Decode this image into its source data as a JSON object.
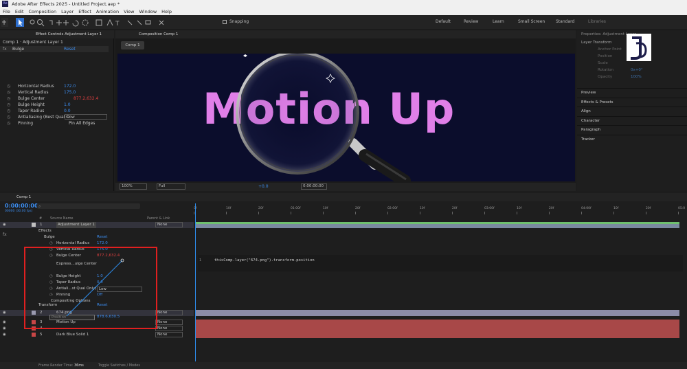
{
  "titlebar": {
    "app_icon": "Ae",
    "title": "Adobe After Effects 2025 - Untitled Project.aep *"
  },
  "menu": [
    "File",
    "Edit",
    "Composition",
    "Layer",
    "Effect",
    "Animation",
    "View",
    "Window",
    "Help"
  ],
  "toolbar": {
    "snapping_label": "Snapping",
    "workspaces": [
      "Default",
      "Review",
      "Learn",
      "Small Screen",
      "Standard",
      "Libraries"
    ]
  },
  "effect_controls": {
    "tab_label": "Effect Controls Adjustment Layer 1",
    "header": "Comp 1 · Adjustment Layer 1",
    "effect_name": "Bulge",
    "reset": "Reset",
    "props": [
      {
        "label": "Horizontal Radius",
        "value": "172.0"
      },
      {
        "label": "Vertical Radius",
        "value": "175.0"
      },
      {
        "label": "Bulge Center",
        "value": "877.2,632.4"
      },
      {
        "label": "Bulge Height",
        "value": "1.0"
      },
      {
        "label": "Taper Radius",
        "value": "0.0"
      },
      {
        "label": "Antialiasing (Best Qual O",
        "value": "Low"
      },
      {
        "label": "Pinning",
        "value": "Pin All Edges"
      }
    ]
  },
  "composition": {
    "panel_label": "Composition Comp 1",
    "tab": "Comp 1",
    "text": "Motion Up",
    "zoom": "100%",
    "resolution": "Full",
    "exposure": "+0.0",
    "timecode": "0:00:00:00"
  },
  "properties": {
    "title": "Properties: Adjustment Layer",
    "section": "Layer Transform",
    "items": [
      "Anchor Point",
      "Position",
      "Scale",
      "Rotation",
      "Opacity"
    ],
    "values": [
      "",
      "",
      "",
      "0x+0°",
      "100%"
    ],
    "panels": [
      "Preview",
      "Effects & Presets",
      "Align",
      "Character",
      "Paragraph",
      "Tracker"
    ]
  },
  "timeline": {
    "tab": "Comp 1",
    "timecode": "0:00:00:00",
    "fps": "00000 (30.00 fps)",
    "search_placeholder": "",
    "col_source": "Source Name",
    "col_parent": "Parent & Link",
    "col_hash": "#",
    "ruler": [
      "0f",
      "10f",
      "20f",
      "01:00f",
      "10f",
      "20f",
      "02:00f",
      "10f",
      "20f",
      "03:00f",
      "10f",
      "20f",
      "04:00f",
      "10f",
      "20f",
      "05:0"
    ],
    "layers": [
      {
        "num": "1",
        "name": "Adjustment Layer 1",
        "parent": "None",
        "color": "#c0c0c0"
      },
      {
        "num": "2",
        "name": "674.png",
        "parent": "None",
        "color": "#9a9ab0"
      },
      {
        "num": "3",
        "name": "Motion Up",
        "parent": "None",
        "color": "#c84646"
      },
      {
        "num": "4",
        "name": "",
        "parent": "None",
        "color": "#c84646"
      },
      {
        "num": "5",
        "name": "Dark Blue Solid 1",
        "parent": "None",
        "color": "#c84646"
      }
    ],
    "effects_label": "Effects",
    "bulge_label": "Bulge",
    "reset": "Reset",
    "bulge_props": [
      {
        "label": "Horizontal Radius",
        "value": "172.0"
      },
      {
        "label": "Vertical Radius",
        "value": "175.0"
      },
      {
        "label": "Bulge Center",
        "value": "877.2,632.4"
      },
      {
        "label": "Express...ulge Center",
        "value": ""
      },
      {
        "label": "Bulge Height",
        "value": "1.0"
      },
      {
        "label": "Taper Radius",
        "value": "0.0"
      },
      {
        "label": "Antiali...st Qual Only)",
        "value": "Low"
      },
      {
        "label": "Pinning",
        "value": "Off"
      },
      {
        "label": "Compositing Options",
        "value": ""
      }
    ],
    "transform_label": "Transform",
    "position_label": "Position",
    "position_value": "878.6,630.5",
    "expression": "thisComp.layer(\"674.png\").transform.position",
    "frame_render": "Frame Render Time:",
    "frame_render_value": "36ms",
    "toggle": "Toggle Switches / Modes"
  },
  "colors": {
    "accent": "#2d8ceb",
    "highlight_box": "#e02020",
    "text_pink": "#e07fe8",
    "comp_bg": "#0b0d2c"
  }
}
